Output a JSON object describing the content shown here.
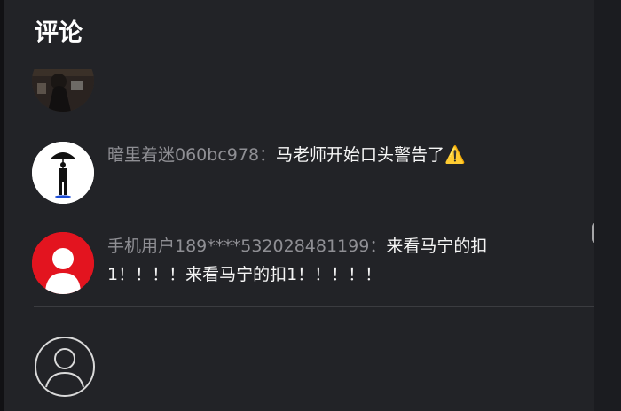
{
  "header": {
    "title": "评论"
  },
  "comments": [
    {
      "username": "暗里着迷060bc978：",
      "content": "马老师开始口头警告了⚠️",
      "avatar_icon": "umbrella-person-avatar"
    },
    {
      "username": "手机用户189****532028481199：",
      "content": "来看马宁的扣1！！！！来看马宁的扣1！！！！！",
      "avatar_icon": "default-user-avatar-red"
    }
  ],
  "composer": {
    "avatar_icon": "user-outline-icon"
  },
  "colors": {
    "panel_bg": "#222327",
    "username": "#8f8f94",
    "content": "#f5f5f5",
    "red_avatar": "#e3141f",
    "divider": "#3b3c40"
  }
}
